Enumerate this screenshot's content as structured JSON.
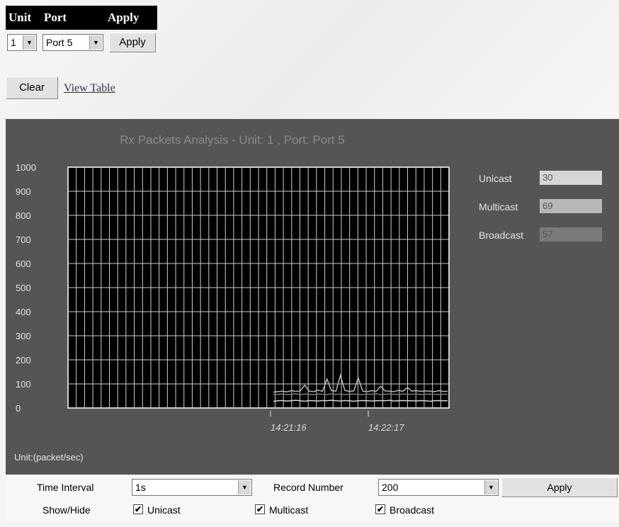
{
  "toolbar": {
    "headers": {
      "unit": "Unit",
      "port": "Port",
      "apply": "Apply"
    },
    "unit_value": "1",
    "port_value": "Port 5",
    "apply_label": "Apply",
    "clear_label": "Clear",
    "view_table_label": "View Table"
  },
  "chart_data": {
    "type": "line",
    "title": "Rx Packets Analysis - Unit: 1 , Port: Port 5",
    "ylim": [
      0,
      1000
    ],
    "y_ticks": [
      "0",
      "100",
      "200",
      "300",
      "400",
      "500",
      "600",
      "700",
      "800",
      "900",
      "1000"
    ],
    "x_tick_labels": [
      "14:21:16",
      "14:22:17"
    ],
    "unit_label": "Unit:(packet/sec)",
    "grid": true,
    "legend_placement": "right",
    "series": [
      {
        "name": "Unicast",
        "current": "30",
        "color": "#d6d6d6",
        "values": [
          28,
          30,
          31,
          29,
          30,
          32,
          30,
          28,
          31,
          30,
          29,
          31,
          30,
          32,
          30,
          29,
          31,
          30,
          28,
          30,
          31,
          30,
          29,
          30,
          31,
          30,
          32,
          29,
          30,
          31,
          30,
          30,
          29,
          31,
          30,
          28,
          30,
          31,
          30,
          30
        ]
      },
      {
        "name": "Multicast",
        "current": "69",
        "color": "#b8b8b8",
        "values": [
          66,
          68,
          70,
          67,
          72,
          69,
          71,
          95,
          70,
          68,
          74,
          69,
          120,
          72,
          70,
          135,
          73,
          69,
          71,
          125,
          70,
          68,
          72,
          69,
          90,
          71,
          70,
          68,
          73,
          69,
          85,
          70,
          72,
          69,
          71,
          70,
          68,
          72,
          69,
          69
        ]
      },
      {
        "name": "Broadcast",
        "current": "57",
        "color": "#7a7a7a",
        "values": [
          55,
          57,
          58,
          56,
          57,
          59,
          56,
          58,
          57,
          55,
          58,
          57,
          56,
          59,
          57,
          58,
          56,
          57,
          58,
          57,
          56,
          58,
          57,
          59,
          56,
          57,
          58,
          57,
          56,
          58,
          57,
          57,
          58,
          56,
          57,
          58,
          57,
          56,
          57,
          57
        ]
      }
    ]
  },
  "controls": {
    "time_interval_label": "Time Interval",
    "time_interval_value": "1s",
    "record_number_label": "Record Number",
    "record_number_value": "200",
    "apply_label": "Apply",
    "show_hide_label": "Show/Hide",
    "show_unicast": true,
    "show_multicast": true,
    "show_broadcast": true,
    "unicast_label": "Unicast",
    "multicast_label": "Multicast",
    "broadcast_label": "Broadcast",
    "check_mark": "✔"
  }
}
